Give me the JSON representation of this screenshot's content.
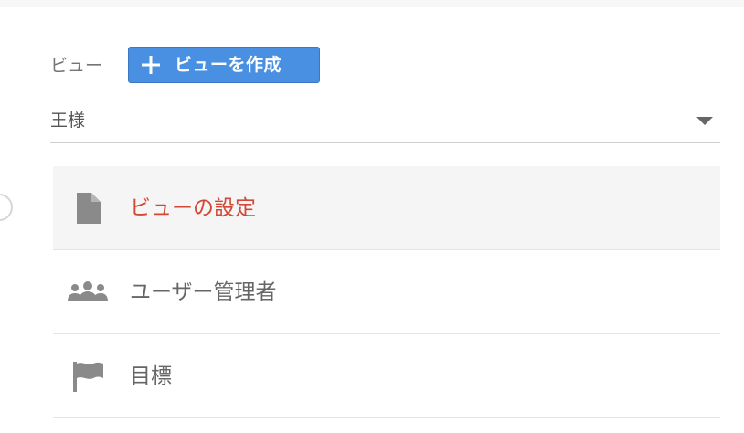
{
  "view_section": {
    "label": "ビュー",
    "create_button_label": "ビューを作成",
    "selected_view": "王様"
  },
  "menu": {
    "items": [
      {
        "label": "ビューの設定",
        "icon": "document-icon",
        "active": true
      },
      {
        "label": "ユーザー管理者",
        "icon": "people-icon",
        "active": false
      },
      {
        "label": "目標",
        "icon": "flag-icon",
        "active": false
      }
    ]
  },
  "colors": {
    "accent_button": "#4a90e2",
    "active_text": "#d14836",
    "icon_gray": "#8a8a8a",
    "text_gray": "#666666"
  }
}
